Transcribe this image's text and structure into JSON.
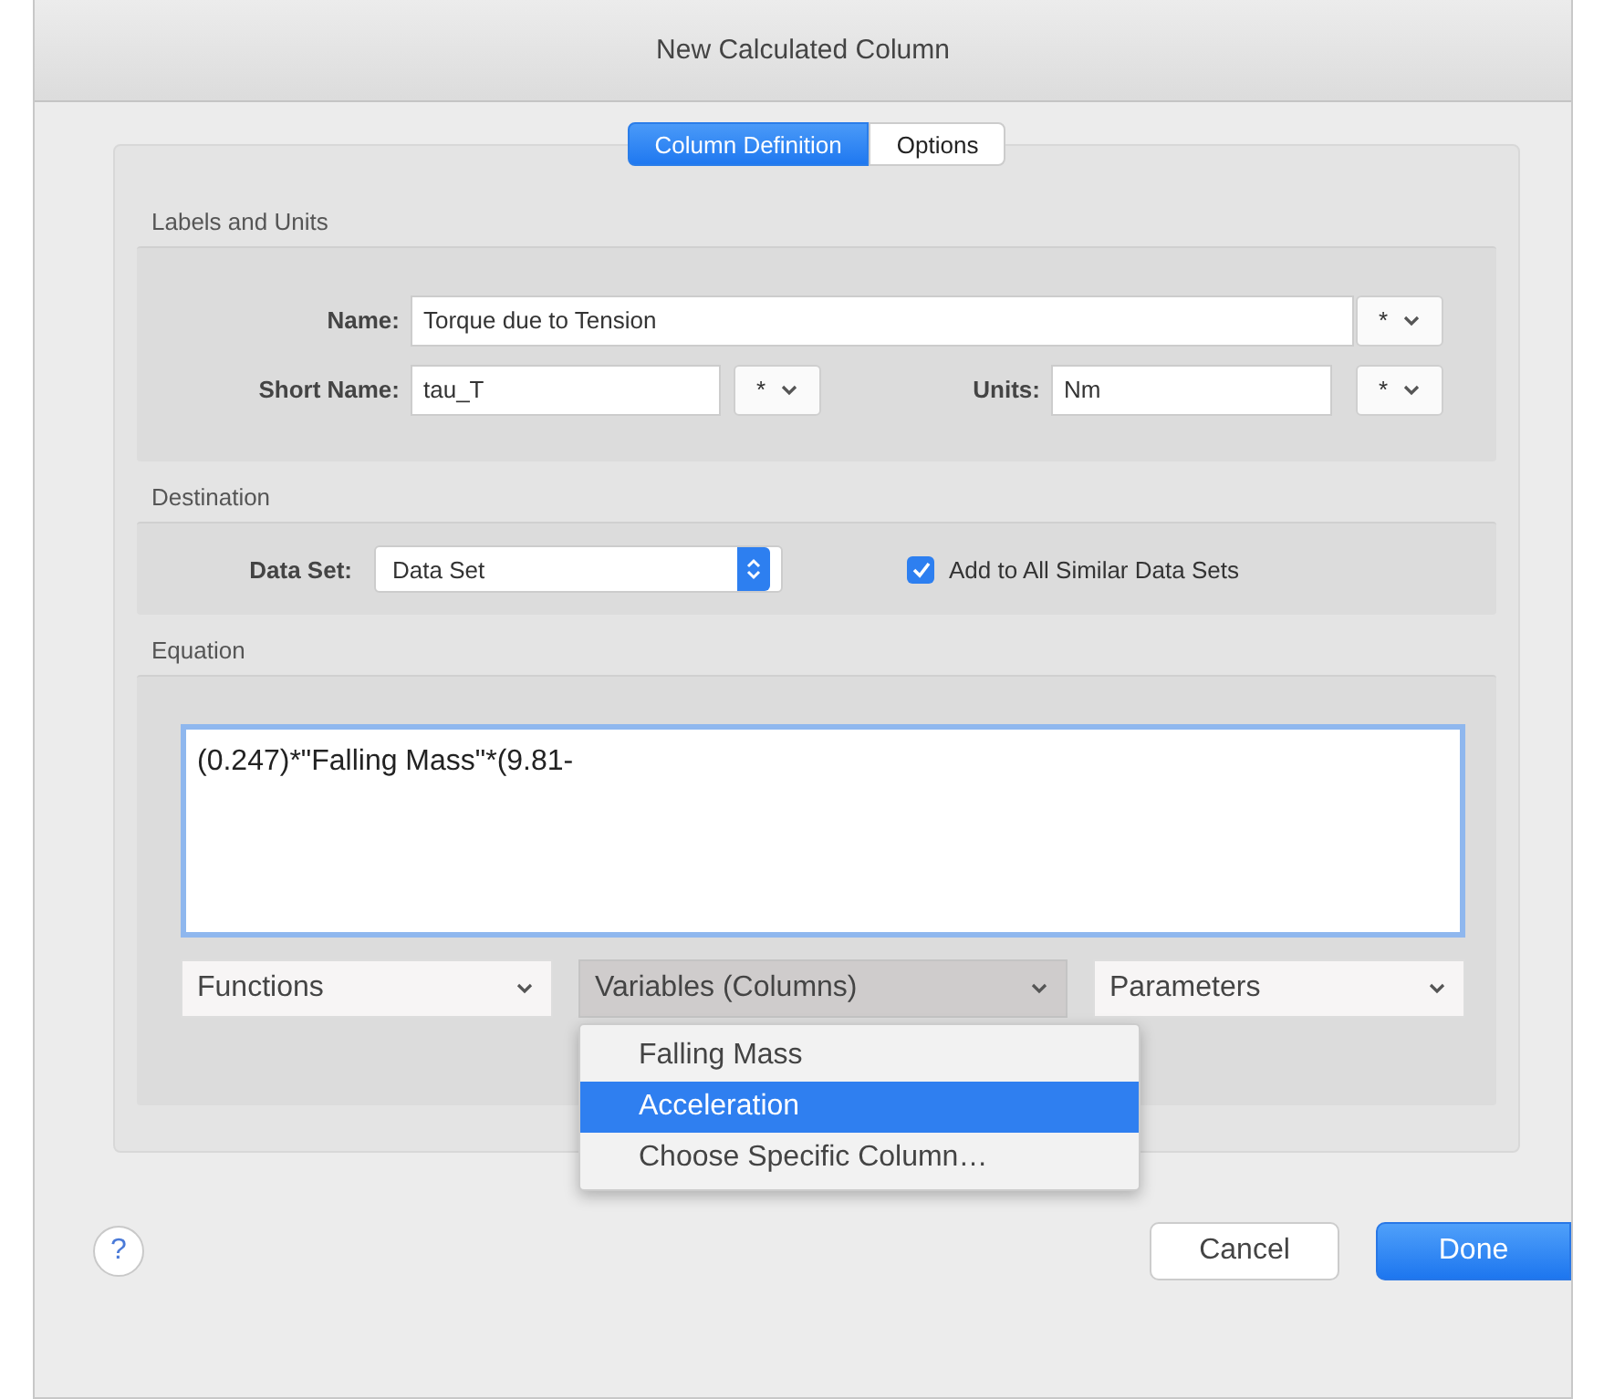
{
  "window": {
    "title": "New Calculated Column"
  },
  "tabs": [
    {
      "label": "Column Definition",
      "selected": true
    },
    {
      "label": "Options",
      "selected": false
    }
  ],
  "labels_and_units": {
    "heading": "Labels and Units",
    "name": {
      "label": "Name:",
      "value": "Torque due to Tension",
      "popup": "*"
    },
    "short_name": {
      "label": "Short Name:",
      "value": "tau_T",
      "popup": "*"
    },
    "units": {
      "label": "Units:",
      "value": "Nm",
      "popup": "*"
    }
  },
  "destination": {
    "heading": "Destination",
    "data_set": {
      "label": "Data Set:",
      "value": "Data Set"
    },
    "add_to_all": {
      "label": "Add to All Similar Data Sets",
      "checked": true
    }
  },
  "equation": {
    "heading": "Equation",
    "value": "(0.247)*\"Falling Mass\"*(9.81-",
    "menus": [
      {
        "label": "Functions",
        "open": false
      },
      {
        "label": "Variables (Columns)",
        "open": true
      },
      {
        "label": "Parameters",
        "open": false
      }
    ],
    "open_menu_items": [
      {
        "label": "Falling Mass",
        "selected": false
      },
      {
        "label": "Acceleration",
        "selected": true
      },
      {
        "label": "Choose Specific Column…",
        "selected": false
      }
    ]
  },
  "help": "?",
  "buttons": [
    {
      "label": "Cancel",
      "kind": "secondary"
    },
    {
      "label": "Done",
      "kind": "primary"
    }
  ]
}
